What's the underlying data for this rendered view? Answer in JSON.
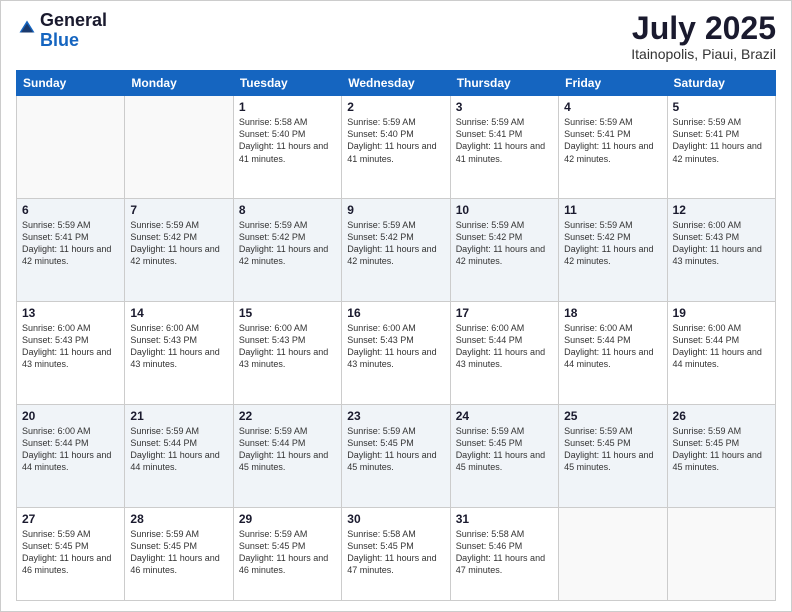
{
  "header": {
    "logo_general": "General",
    "logo_blue": "Blue",
    "month_title": "July 2025",
    "location": "Itainopolis, Piaui, Brazil"
  },
  "days_of_week": [
    "Sunday",
    "Monday",
    "Tuesday",
    "Wednesday",
    "Thursday",
    "Friday",
    "Saturday"
  ],
  "weeks": [
    [
      {
        "day": "",
        "info": ""
      },
      {
        "day": "",
        "info": ""
      },
      {
        "day": "1",
        "info": "Sunrise: 5:58 AM\nSunset: 5:40 PM\nDaylight: 11 hours and 41 minutes."
      },
      {
        "day": "2",
        "info": "Sunrise: 5:59 AM\nSunset: 5:40 PM\nDaylight: 11 hours and 41 minutes."
      },
      {
        "day": "3",
        "info": "Sunrise: 5:59 AM\nSunset: 5:41 PM\nDaylight: 11 hours and 41 minutes."
      },
      {
        "day": "4",
        "info": "Sunrise: 5:59 AM\nSunset: 5:41 PM\nDaylight: 11 hours and 42 minutes."
      },
      {
        "day": "5",
        "info": "Sunrise: 5:59 AM\nSunset: 5:41 PM\nDaylight: 11 hours and 42 minutes."
      }
    ],
    [
      {
        "day": "6",
        "info": "Sunrise: 5:59 AM\nSunset: 5:41 PM\nDaylight: 11 hours and 42 minutes."
      },
      {
        "day": "7",
        "info": "Sunrise: 5:59 AM\nSunset: 5:42 PM\nDaylight: 11 hours and 42 minutes."
      },
      {
        "day": "8",
        "info": "Sunrise: 5:59 AM\nSunset: 5:42 PM\nDaylight: 11 hours and 42 minutes."
      },
      {
        "day": "9",
        "info": "Sunrise: 5:59 AM\nSunset: 5:42 PM\nDaylight: 11 hours and 42 minutes."
      },
      {
        "day": "10",
        "info": "Sunrise: 5:59 AM\nSunset: 5:42 PM\nDaylight: 11 hours and 42 minutes."
      },
      {
        "day": "11",
        "info": "Sunrise: 5:59 AM\nSunset: 5:42 PM\nDaylight: 11 hours and 42 minutes."
      },
      {
        "day": "12",
        "info": "Sunrise: 6:00 AM\nSunset: 5:43 PM\nDaylight: 11 hours and 43 minutes."
      }
    ],
    [
      {
        "day": "13",
        "info": "Sunrise: 6:00 AM\nSunset: 5:43 PM\nDaylight: 11 hours and 43 minutes."
      },
      {
        "day": "14",
        "info": "Sunrise: 6:00 AM\nSunset: 5:43 PM\nDaylight: 11 hours and 43 minutes."
      },
      {
        "day": "15",
        "info": "Sunrise: 6:00 AM\nSunset: 5:43 PM\nDaylight: 11 hours and 43 minutes."
      },
      {
        "day": "16",
        "info": "Sunrise: 6:00 AM\nSunset: 5:43 PM\nDaylight: 11 hours and 43 minutes."
      },
      {
        "day": "17",
        "info": "Sunrise: 6:00 AM\nSunset: 5:44 PM\nDaylight: 11 hours and 43 minutes."
      },
      {
        "day": "18",
        "info": "Sunrise: 6:00 AM\nSunset: 5:44 PM\nDaylight: 11 hours and 44 minutes."
      },
      {
        "day": "19",
        "info": "Sunrise: 6:00 AM\nSunset: 5:44 PM\nDaylight: 11 hours and 44 minutes."
      }
    ],
    [
      {
        "day": "20",
        "info": "Sunrise: 6:00 AM\nSunset: 5:44 PM\nDaylight: 11 hours and 44 minutes."
      },
      {
        "day": "21",
        "info": "Sunrise: 5:59 AM\nSunset: 5:44 PM\nDaylight: 11 hours and 44 minutes."
      },
      {
        "day": "22",
        "info": "Sunrise: 5:59 AM\nSunset: 5:44 PM\nDaylight: 11 hours and 45 minutes."
      },
      {
        "day": "23",
        "info": "Sunrise: 5:59 AM\nSunset: 5:45 PM\nDaylight: 11 hours and 45 minutes."
      },
      {
        "day": "24",
        "info": "Sunrise: 5:59 AM\nSunset: 5:45 PM\nDaylight: 11 hours and 45 minutes."
      },
      {
        "day": "25",
        "info": "Sunrise: 5:59 AM\nSunset: 5:45 PM\nDaylight: 11 hours and 45 minutes."
      },
      {
        "day": "26",
        "info": "Sunrise: 5:59 AM\nSunset: 5:45 PM\nDaylight: 11 hours and 45 minutes."
      }
    ],
    [
      {
        "day": "27",
        "info": "Sunrise: 5:59 AM\nSunset: 5:45 PM\nDaylight: 11 hours and 46 minutes."
      },
      {
        "day": "28",
        "info": "Sunrise: 5:59 AM\nSunset: 5:45 PM\nDaylight: 11 hours and 46 minutes."
      },
      {
        "day": "29",
        "info": "Sunrise: 5:59 AM\nSunset: 5:45 PM\nDaylight: 11 hours and 46 minutes."
      },
      {
        "day": "30",
        "info": "Sunrise: 5:58 AM\nSunset: 5:45 PM\nDaylight: 11 hours and 47 minutes."
      },
      {
        "day": "31",
        "info": "Sunrise: 5:58 AM\nSunset: 5:46 PM\nDaylight: 11 hours and 47 minutes."
      },
      {
        "day": "",
        "info": ""
      },
      {
        "day": "",
        "info": ""
      }
    ]
  ]
}
